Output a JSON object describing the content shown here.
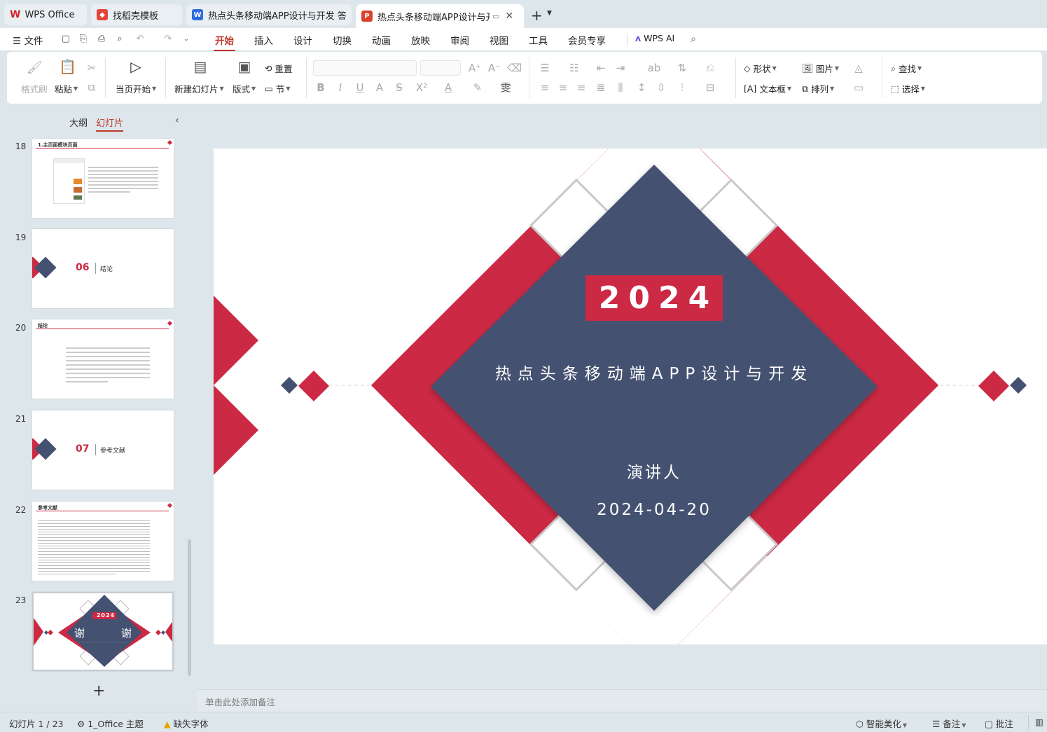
{
  "tabs": [
    {
      "label": "WPS Office",
      "icon": "wps-logo-icon"
    },
    {
      "label": "找稻壳模板",
      "icon": "docer-icon"
    },
    {
      "label": "热点头条移动端APP设计与开发 答辩稿",
      "icon": "writer-doc-icon"
    },
    {
      "label": "热点头条移动端APP设计与开发",
      "icon": "presentation-doc-icon"
    }
  ],
  "menu": {
    "file": "文件",
    "items": [
      "开始",
      "插入",
      "设计",
      "切换",
      "动画",
      "放映",
      "审阅",
      "视图",
      "工具",
      "会员专享"
    ],
    "selected": "开始",
    "wps_ai": "WPS AI"
  },
  "ribbon": {
    "format_painter": "格式刷",
    "paste": "粘贴",
    "from_current": "当页开始",
    "new_slide": "新建幻灯片",
    "layout": "版式",
    "reset": "重置",
    "section": "节",
    "shape": "形状",
    "picture": "图片",
    "textbox": "文本框",
    "arrange": "排列",
    "find": "查找",
    "select": "选择"
  },
  "panel": {
    "outline": "大纲",
    "slides": "幻灯片"
  },
  "thumbnails": [
    {
      "num": "18",
      "title": "1.主页面模块页面"
    },
    {
      "num": "19",
      "section_no": "06",
      "section_title": "结论"
    },
    {
      "num": "20",
      "title": "结论"
    },
    {
      "num": "21",
      "section_no": "07",
      "section_title": "参考文献"
    },
    {
      "num": "22",
      "title": "参考文献"
    },
    {
      "num": "23",
      "year": "2024",
      "thanks_left": "谢",
      "thanks_right": "谢"
    }
  ],
  "slide": {
    "year": "2024",
    "title": "热点头条移动端APP设计与开发",
    "presenter": "演讲人",
    "date": "2024-04-20"
  },
  "notes_placeholder": "单击此处添加备注",
  "status": {
    "slide_counter": "幻灯片 1 / 23",
    "theme": "1_Office 主题",
    "missing_font": "缺失字体",
    "smart_beautify": "智能美化",
    "notes": "备注",
    "comments": "批注"
  },
  "colors": {
    "accent_red": "#cc2944",
    "navy": "#455171",
    "wps_red": "#c0392b"
  }
}
